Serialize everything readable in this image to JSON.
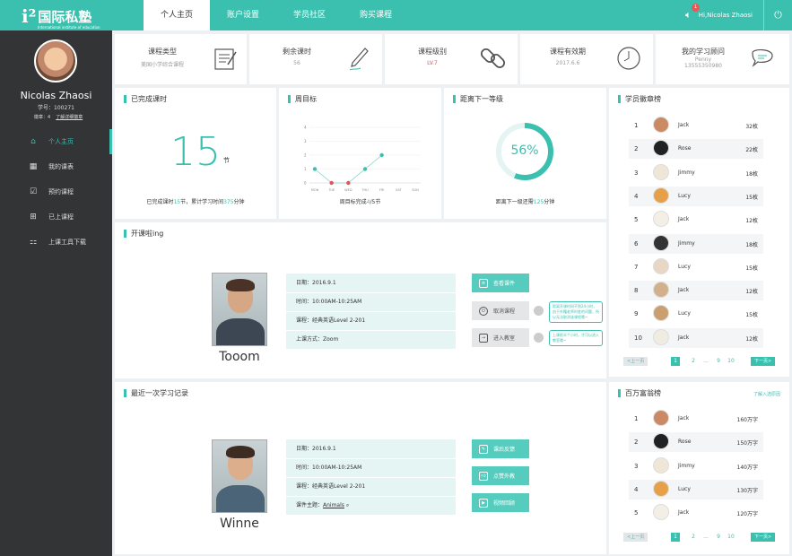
{
  "header": {
    "logo_text": "国际私塾",
    "logo_sub": "International institute of education",
    "tabs": [
      "个人主页",
      "账户设置",
      "学员社区",
      "购买课程"
    ],
    "badge": "1",
    "greeting": "Hi,Nicolas Zhaosi"
  },
  "user": {
    "name": "Nicolas Zhaosi",
    "id_label": "学号：100271",
    "medal_label": "徽章：4",
    "medal_link": "了解详细徽章"
  },
  "menu": [
    {
      "label": "个人主页",
      "icon": "home-icon"
    },
    {
      "label": "我的课表",
      "icon": "calendar-icon"
    },
    {
      "label": "预约课程",
      "icon": "check-icon"
    },
    {
      "label": "已上课程",
      "icon": "plus-box-icon"
    },
    {
      "label": "上课工具下载",
      "icon": "grid-icon"
    }
  ],
  "stats": [
    {
      "title": "课程类型",
      "value": "美国小学综合课程"
    },
    {
      "title": "剩余课时",
      "value": "56"
    },
    {
      "title": "课程级别",
      "value": "LV.7"
    },
    {
      "title": "课程有效期",
      "value": "2017.6.6"
    },
    {
      "title": "我的学习顾问",
      "value": "Penny",
      "value2": "13555350980"
    }
  ],
  "completed": {
    "title": "已完成课时",
    "value": "15",
    "unit": "节",
    "foot_pre": "已完成课时",
    "foot_n": "15",
    "foot_mid": "节，累计学习时间",
    "foot_n2": "375",
    "foot_post": "分钟"
  },
  "weekly": {
    "title": "周目标",
    "foot_pre": "周目标完成",
    "foot_n": "4",
    "foot_post": "/5节"
  },
  "chart_data": {
    "type": "line",
    "categories": [
      "MON",
      "TUE",
      "WED",
      "THU",
      "FRI",
      "SAT",
      "SUN"
    ],
    "values": [
      1,
      0,
      0,
      1,
      2,
      null,
      null
    ],
    "ylim": [
      0,
      4
    ],
    "yticks": [
      "4",
      "3",
      "2",
      "1",
      "0"
    ],
    "point_colors": [
      "#3bbfae",
      "#e05555",
      "#e05555",
      "#3bbfae",
      "#3bbfae"
    ]
  },
  "nextlevel": {
    "title": "距离下一等级",
    "percent_text": "56%",
    "percent": 56,
    "foot_pre": "距离下一级还需",
    "foot_n": "125",
    "foot_post": "分钟"
  },
  "badges_rank": {
    "title": "学员徽章榜",
    "rows": [
      {
        "no": "1",
        "name": "Jack",
        "count": "32枚"
      },
      {
        "no": "2",
        "name": "Rose",
        "count": "22枚"
      },
      {
        "no": "3",
        "name": "Jimmy",
        "count": "18枚"
      },
      {
        "no": "4",
        "name": "Lucy",
        "count": "15枚"
      },
      {
        "no": "5",
        "name": "Jack",
        "count": "12枚"
      },
      {
        "no": "6",
        "name": "Jimmy",
        "count": "18枚"
      },
      {
        "no": "7",
        "name": "Lucy",
        "count": "15枚"
      },
      {
        "no": "8",
        "name": "Jack",
        "count": "12枚"
      },
      {
        "no": "9",
        "name": "Lucy",
        "count": "15枚"
      },
      {
        "no": "10",
        "name": "Jack",
        "count": "12枚"
      }
    ],
    "prev": "<上一页",
    "next": "下一页>",
    "pages": [
      "1",
      "2",
      "...",
      "9",
      "10"
    ]
  },
  "rich_rank": {
    "title": "百万富翁榜",
    "link": "了解入选原因",
    "rows": [
      {
        "no": "1",
        "name": "Jack",
        "count": "160万字"
      },
      {
        "no": "2",
        "name": "Rose",
        "count": "150万字"
      },
      {
        "no": "3",
        "name": "Jimmy",
        "count": "140万字"
      },
      {
        "no": "4",
        "name": "Lucy",
        "count": "130万字"
      },
      {
        "no": "5",
        "name": "Jack",
        "count": "120万字"
      }
    ],
    "prev": "<上一页",
    "next": "下一页>",
    "pages": [
      "1",
      "2",
      "...",
      "9",
      "10"
    ]
  },
  "opening": {
    "title": "开课啦ing",
    "teacher": "Tooom",
    "lines": [
      "日期：2016.9.1",
      "时间：10:00AM-10:25AM",
      "课程：经典英语Level 2-201",
      "上课方式：Zoom"
    ],
    "buttons": [
      "查看课件",
      "取消课程",
      "进入教室"
    ],
    "tip1": "距离开课时间不到24小时，由于外籍老师时差的问题，所以无法取消该课程哦~",
    "tip2": "上课前半个小时，才可以进入教室哦~"
  },
  "recent": {
    "title": "最近一次学习记录",
    "teacher": "Winne",
    "lines": [
      "日期：2016.9.1",
      "时间：10:00AM-10:25AM",
      "课程：经典英语Level 2-201"
    ],
    "topic_label": "课件主题：",
    "topic": "Animals",
    "buttons": [
      "课后反馈",
      "点赞外教",
      "视频回顾"
    ]
  }
}
